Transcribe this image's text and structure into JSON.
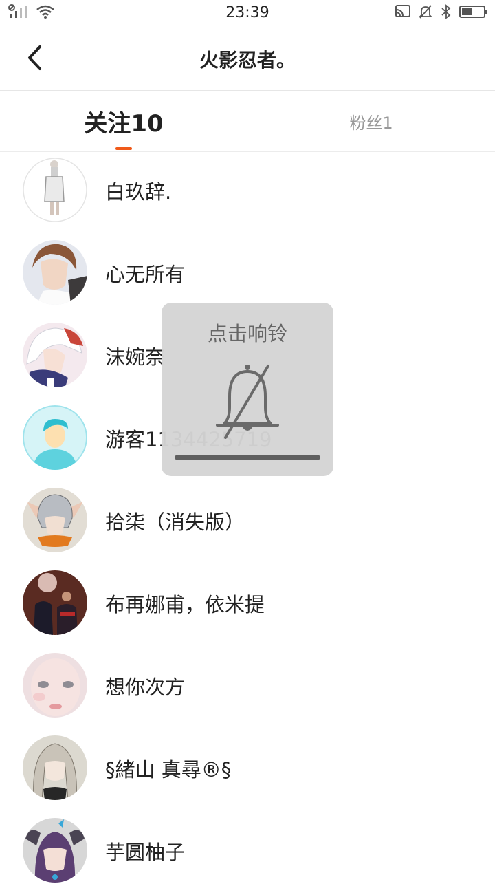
{
  "status_bar": {
    "time": "23:39",
    "icons": [
      "signal-icon",
      "wifi-icon",
      "cast-icon",
      "bell-off-icon",
      "bluetooth-icon",
      "battery-icon"
    ]
  },
  "header": {
    "title": "火影忍者。",
    "back_icon": "chevron-left-icon"
  },
  "tabs": {
    "following": "关注10",
    "fans": "粉丝1",
    "accent_color": "#f05a1a"
  },
  "users": [
    {
      "name": "白玖辞."
    },
    {
      "name": "心无所有"
    },
    {
      "name": "沫婉奈"
    },
    {
      "name": "游客1134425719"
    },
    {
      "name": "拾柒（消失版）"
    },
    {
      "name": "布再娜甫，依米提"
    },
    {
      "name": "想你次方"
    },
    {
      "name": "§緒山 真尋®§"
    },
    {
      "name": "芋圆柚子"
    }
  ],
  "toast": {
    "text": "点击响铃",
    "icon": "bell-off-icon"
  }
}
